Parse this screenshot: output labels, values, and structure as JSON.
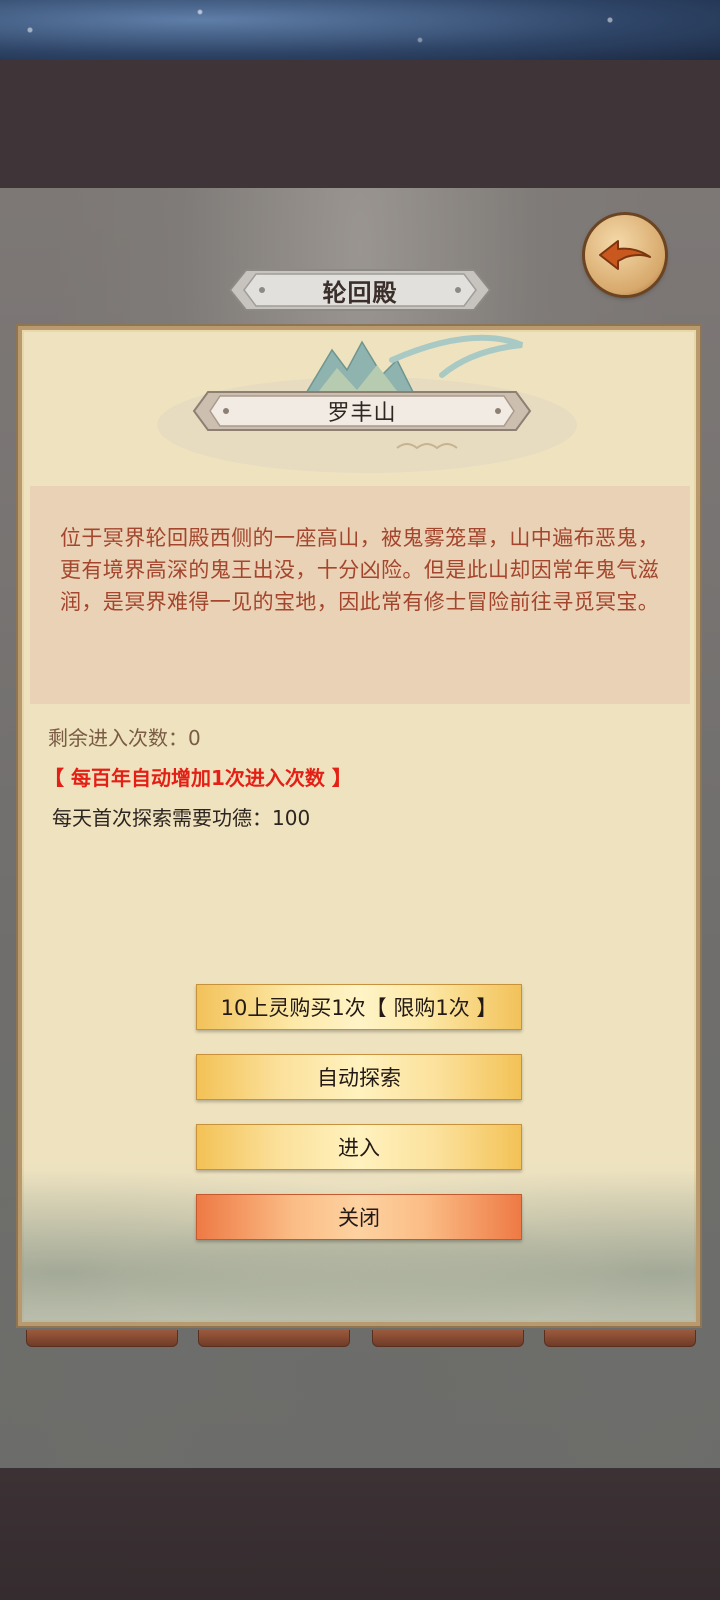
{
  "window": {
    "title": "轮回殿"
  },
  "location": {
    "name": "罗丰山",
    "description": "位于冥界轮回殿西侧的一座高山，被鬼雾笼罩，山中遍布恶鬼，更有境界高深的鬼王出没，十分凶险。但是此山却因常年鬼气滋润，是冥界难得一见的宝地，因此常有修士冒险前往寻觅冥宝。"
  },
  "info": {
    "remaining_entries": "剩余进入次数：0",
    "auto_increase_note": "【 每百年自动增加1次进入次数 】",
    "daily_cost": "每天首次探索需要功德：100"
  },
  "buttons": {
    "buy": "10上灵购买1次【 限购1次 】",
    "auto_explore": "自动探索",
    "enter": "进入",
    "close": "关闭"
  },
  "icons": {
    "back": "back-arrow-icon"
  },
  "colors": {
    "panel_bg": "#efe3bf",
    "desc_bg": "#ead2b6",
    "desc_text": "#a4462d",
    "alert_red": "#e41f15",
    "gold_button": "#f2c25a",
    "orange_button": "#ee7a45"
  }
}
